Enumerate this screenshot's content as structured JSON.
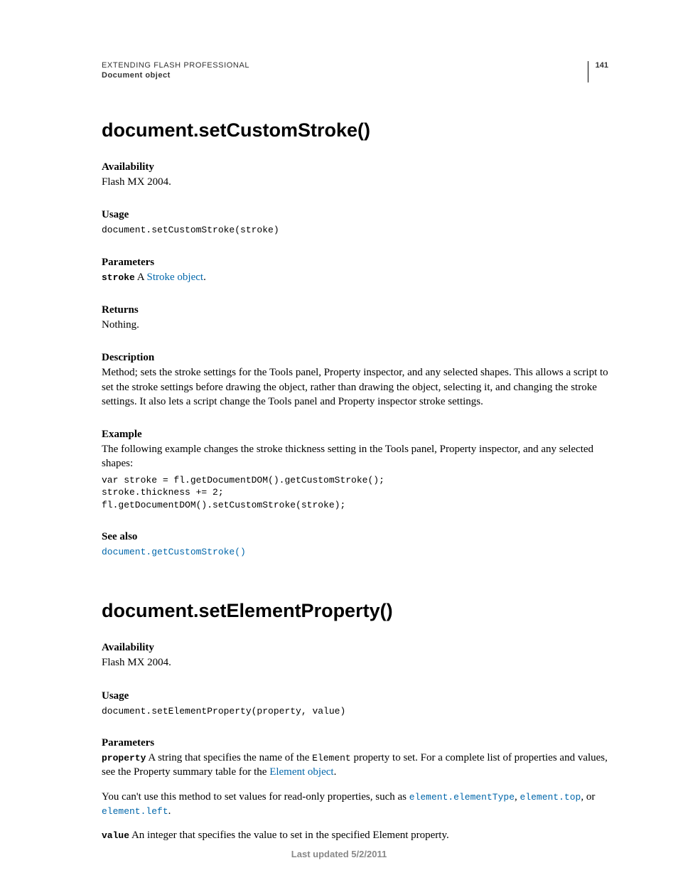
{
  "header": {
    "title": "EXTENDING FLASH PROFESSIONAL",
    "subtitle": "Document object",
    "page_number": "141"
  },
  "section1": {
    "heading": "document.setCustomStroke()",
    "availability_label": "Availability",
    "availability_text": "Flash MX 2004.",
    "usage_label": "Usage",
    "usage_code": "document.setCustomStroke(stroke)",
    "parameters_label": "Parameters",
    "param_name": "stroke",
    "param_pre": " A ",
    "param_link": "Stroke object",
    "param_post": ".",
    "returns_label": "Returns",
    "returns_text": "Nothing.",
    "description_label": "Description",
    "description_text": "Method; sets the stroke settings for the Tools panel, Property inspector, and any selected shapes. This allows a script to set the stroke settings before drawing the object, rather than drawing the object, selecting it, and changing the stroke settings. It also lets a script change the Tools panel and Property inspector stroke settings.",
    "example_label": "Example",
    "example_text": "The following example changes the stroke thickness setting in the Tools panel, Property inspector, and any selected shapes:",
    "example_code": "var stroke = fl.getDocumentDOM().getCustomStroke(); \nstroke.thickness += 2; \nfl.getDocumentDOM().setCustomStroke(stroke);",
    "seealso_label": "See also",
    "seealso_link": "document.getCustomStroke()"
  },
  "section2": {
    "heading": "document.setElementProperty()",
    "availability_label": "Availability",
    "availability_text": "Flash MX 2004.",
    "usage_label": "Usage",
    "usage_code": "document.setElementProperty(property, value)",
    "parameters_label": "Parameters",
    "param1_name": "property",
    "param1_text_a": " A string that specifies the name of the ",
    "param1_mono": "Element",
    "param1_text_b": " property to set. For a complete list of properties and values, see the Property summary table for the ",
    "param1_link": "Element object",
    "param1_text_c": ".",
    "readonly_pre": "You can't use this method to set values for read-only properties, such as ",
    "readonly_link1": "element.elementType",
    "readonly_sep1": ", ",
    "readonly_link2": "element.top",
    "readonly_sep2": ", or ",
    "readonly_link3": "element.left",
    "readonly_post": ".",
    "param2_name": "value",
    "param2_text": " An integer that specifies the value to set in the specified Element property."
  },
  "footer": {
    "text": "Last updated 5/2/2011"
  }
}
